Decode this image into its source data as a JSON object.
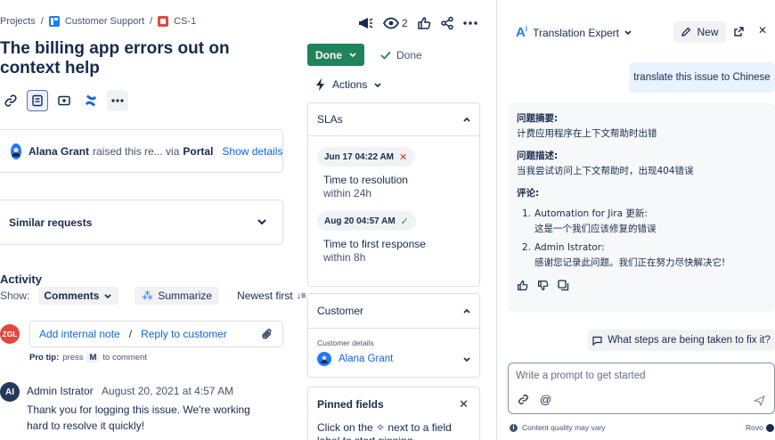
{
  "breadcrumb": {
    "projects": "Projects",
    "sep": "/",
    "project": "Customer Support",
    "issue": "CS-1"
  },
  "issue": {
    "title": "The billing app errors out on context help",
    "watchers": "2"
  },
  "raised": {
    "name": "Alana Grant",
    "text": "raised this re... via",
    "via": "Portal",
    "show": "Show details"
  },
  "similar": "Similar requests",
  "activity": {
    "heading": "Activity",
    "show_label": "Show:",
    "filter": "Comments",
    "summarize": "Summarize",
    "sort": "Newest first",
    "avatar": "ZGL",
    "add_note": "Add internal note",
    "slash": "/",
    "reply": "Reply to customer",
    "tip_label": "Pro tip:",
    "tip_press": "press",
    "tip_key": "M",
    "tip_rest": "to comment",
    "comment": {
      "avatar": "AI",
      "author": "Admin Istrator",
      "date": "August 20, 2021 at 4:57 AM",
      "body": "Thank you for logging this issue. We're working hard to resolve it quickly!"
    }
  },
  "status": {
    "button": "Done",
    "done": "Done",
    "actions": "Actions"
  },
  "slas": {
    "heading": "SLAs",
    "items": [
      {
        "date": "Jun 17 04:22 AM",
        "state": "breached",
        "name": "Time to resolution",
        "goal": "within 24h"
      },
      {
        "date": "Aug 20 04:57 AM",
        "state": "met",
        "name": "Time to first response",
        "goal": "within 8h"
      }
    ]
  },
  "customer": {
    "heading": "Customer",
    "label": "Customer details",
    "name": "Alana Grant"
  },
  "pinned": {
    "heading": "Pinned fields",
    "hint": "Click on the ✧ next to a field label to start pinning"
  },
  "assistant": {
    "title": "Translation Expert",
    "new": "New",
    "user_msg": "translate this issue to Chinese",
    "summary_label": "问题摘要:",
    "summary": "计费应用程序在上下文帮助时出错",
    "desc_label": "问题描述:",
    "desc": "当我尝试访问上下文帮助时，出现404错误",
    "comments_label": "评论:",
    "comments": [
      {
        "num": "1.",
        "head": "Automation for Jira 更新:",
        "body": "这是一个我们应该修复的错误"
      },
      {
        "num": "2.",
        "head": "Admin Istrator:",
        "body": "感谢您记录此问题。我们正在努力尽快解决它!"
      }
    ],
    "suggestion": "What steps are being taken to fix it?",
    "placeholder": "Write a prompt to get started",
    "footer_left": "Content quality may vary",
    "footer_right": "Rovo"
  },
  "colors": {
    "accent": "#0c66e4",
    "done": "#1f845a",
    "avatar_zgl": "#e2483d",
    "avatar_ai": "#253858"
  }
}
